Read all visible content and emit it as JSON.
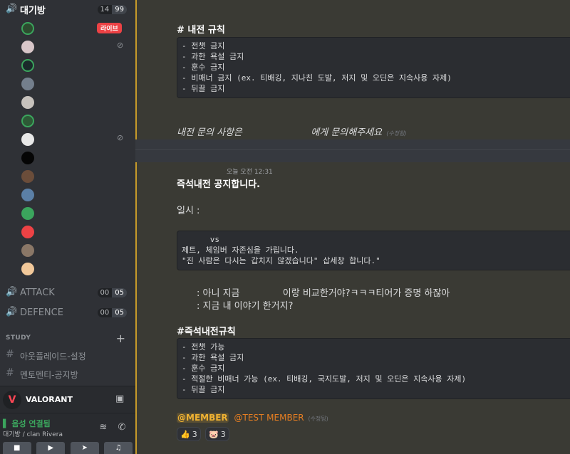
{
  "sidebar": {
    "voice_channels": [
      {
        "name": "대기방",
        "count_a": "14",
        "count_b": "99"
      },
      {
        "name": "ATTACK",
        "count_a": "00",
        "count_b": "05"
      },
      {
        "name": "DEFENCE",
        "count_a": "00",
        "count_b": "05"
      }
    ],
    "live_badge": "라이브",
    "category": "STUDY",
    "text_channels": [
      {
        "name": "아웃플레이드-설정"
      },
      {
        "name": "멘토멘티-공지방"
      }
    ],
    "game": {
      "name": "VALORANT"
    },
    "voice_panel": {
      "status": "음성 연결됨",
      "location": "대기방 / clan Rivera"
    }
  },
  "chat": {
    "msg1": {
      "heading": "# 내전 규칙",
      "rules": "- 전챗 금지\n- 과한 욕설 금지\n- 훈수 금지\n- 비매너 금지 (ex. 티배깅, 지나친 도발, 저지 및 오딘은 지속사용 자제)\n- 뒤끌 금지",
      "inquiry_prefix": "내전 문의 사항은",
      "inquiry_suffix": "에게 문의해주세요",
      "edited": "(수정됨)"
    },
    "msg2": {
      "time": "오늘 오전 12:31",
      "title": "즉석내전 공지합니다.",
      "date_label": "일시 :",
      "vs_block": "      vs\n제트, 체임버 자존심을 가립니다.\n\"진 사람은 다시는 갑치지 않겠습니다\" 삽세창 합니다.\"",
      "quote1_a": ": 아니 지금",
      "quote1_b": "이랑 비교한거야?ㅋㅋㅋ티어가 증명 하잖아",
      "quote2": ": 지금 내 이야기 한거지?",
      "rules_heading": "#즉석내전규칙",
      "rules": "- 전챗 가능\n- 과한 욕설 금지\n- 훈수 금지\n- 적절한 비매너 가능 (ex. 티배깅, 국지도발, 저지 및 오딘은 지속사용 자제)\n- 뒤끌 금지",
      "mention1": "@MEMBER",
      "mention2": "@TEST MEMBER",
      "edited": "(수정됨)",
      "reactions": [
        {
          "emoji": "👍",
          "count": "3"
        },
        {
          "emoji": "🐷",
          "count": "3"
        }
      ]
    }
  }
}
